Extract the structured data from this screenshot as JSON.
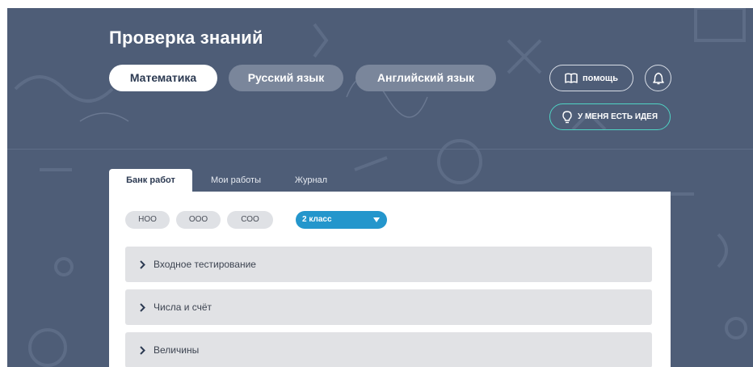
{
  "header": {
    "title": "Проверка знаний",
    "subjects": [
      "Математика",
      "Русский язык",
      "Английский язык"
    ],
    "help_label": "помощь",
    "idea_label": "У МЕНЯ ЕСТЬ ИДЕЯ"
  },
  "tabs": [
    "Банк работ",
    "Мои работы",
    "Журнал"
  ],
  "filters": {
    "levels": [
      "НОО",
      "ООО",
      "СОО"
    ],
    "grade": "2 класс"
  },
  "sections": [
    "Входное тестирование",
    "Числа и счёт",
    "Величины"
  ],
  "colors": {
    "background": "#4e5d77",
    "accent_blue": "#2496cc",
    "accent_teal": "#4fd3c4",
    "section_bg": "#e1e2e5"
  },
  "icons": {
    "help": "book-icon",
    "bell": "bell-icon",
    "idea": "lightbulb-icon",
    "grade_dropdown": "caret-down-icon",
    "section": "chevron-right-icon"
  }
}
